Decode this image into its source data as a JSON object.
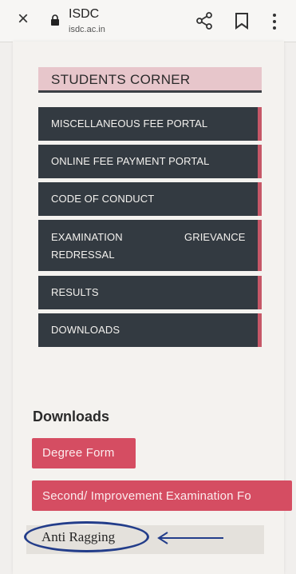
{
  "browser": {
    "close_glyph": "×",
    "site_name": "ISDC",
    "site_domain": "isdc.ac.in",
    "icons": [
      "close-icon",
      "lock-icon",
      "share-icon",
      "bookmark-icon",
      "more-vert-icon"
    ]
  },
  "students_corner": {
    "title": "STUDENTS CORNER",
    "items": [
      {
        "label": "MISCELLANEOUS FEE PORTAL"
      },
      {
        "label": "ONLINE FEE PAYMENT PORTAL"
      },
      {
        "label": "CODE OF CONDUCT"
      },
      {
        "label_parts": [
          "EXAMINATION",
          "GRIEVANCE",
          "REDRESSAL"
        ]
      },
      {
        "label": "RESULTS"
      },
      {
        "label": "DOWNLOADS"
      }
    ]
  },
  "downloads": {
    "heading": "Downloads",
    "buttons": [
      {
        "label": "Degree Form"
      },
      {
        "label": "Second/ Improvement Examination Fo"
      },
      {
        "label": "Anti Ragging"
      }
    ]
  },
  "colors": {
    "menu_bg": "#333a41",
    "menu_accent": "#c65767",
    "header_bg": "#e7c6cb",
    "button_bg": "#d54d62",
    "annotation": "#233d8a"
  }
}
